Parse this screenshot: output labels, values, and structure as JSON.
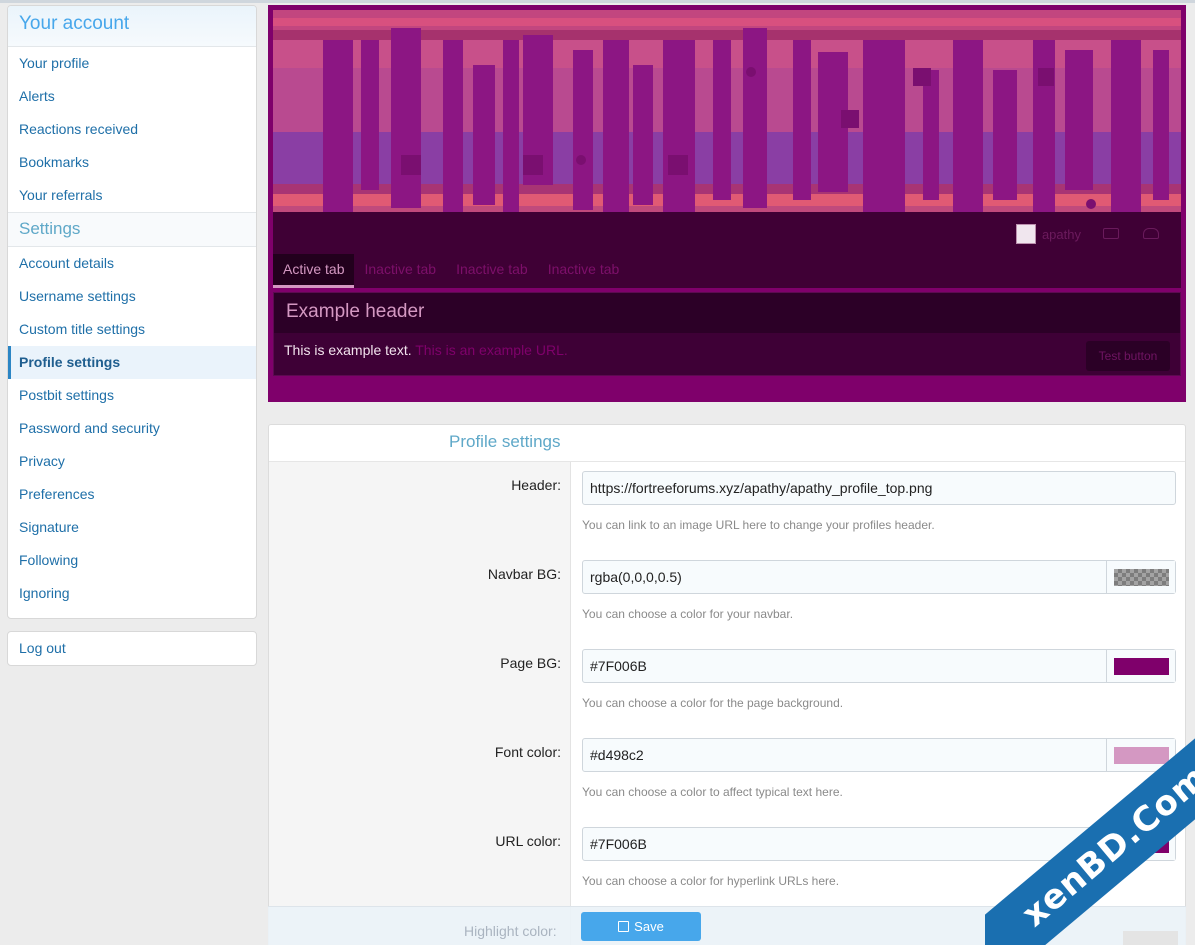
{
  "sidebar": {
    "account_title": "Your account",
    "account_items": [
      {
        "label": "Your profile"
      },
      {
        "label": "Alerts"
      },
      {
        "label": "Reactions received"
      },
      {
        "label": "Bookmarks"
      },
      {
        "label": "Your referrals"
      }
    ],
    "settings_title": "Settings",
    "settings_items": [
      {
        "label": "Account details"
      },
      {
        "label": "Username settings"
      },
      {
        "label": "Custom title settings"
      },
      {
        "label": "Profile settings",
        "active": true
      },
      {
        "label": "Postbit settings"
      },
      {
        "label": "Password and security"
      },
      {
        "label": "Privacy"
      },
      {
        "label": "Preferences"
      },
      {
        "label": "Signature"
      },
      {
        "label": "Following"
      },
      {
        "label": "Ignoring"
      }
    ],
    "logout_label": "Log out"
  },
  "preview": {
    "username": "apathy",
    "tabs": [
      "Active tab",
      "Inactive tab",
      "Inactive tab",
      "Inactive tab"
    ],
    "example_header": "Example header",
    "example_text": "This is example text.",
    "example_url": "This is an example URL.",
    "test_button": "Test button",
    "colors": {
      "page_bg": "#7F006B",
      "font": "#d498c2",
      "url": "#7F006B",
      "banner": "#c2467f"
    }
  },
  "form": {
    "title": "Profile settings",
    "fields": [
      {
        "label": "Header:",
        "value": "https://fortreeforums.xyz/apathy/apathy_profile_top.png",
        "hint": "You can link to an image URL here to change your profiles header."
      },
      {
        "label": "Navbar BG:",
        "value": "rgba(0,0,0,0.5)",
        "hint": "You can choose a color for your navbar.",
        "swatch": "rgba(0,0,0,0.5)"
      },
      {
        "label": "Page BG:",
        "value": "#7F006B",
        "hint": "You can choose a color for the page background.",
        "swatch": "#7F006B"
      },
      {
        "label": "Font color:",
        "value": "#d498c2",
        "hint": "You can choose a color to affect typical text here.",
        "swatch": "#d498c2"
      },
      {
        "label": "URL color:",
        "value": "#7F006B",
        "hint": "You can choose a color for hyperlink URLs here.",
        "swatch": "#7F006B"
      }
    ],
    "highlight_label": "Highlight color:",
    "save_label": "Save"
  },
  "watermark": "xenBD.Com"
}
